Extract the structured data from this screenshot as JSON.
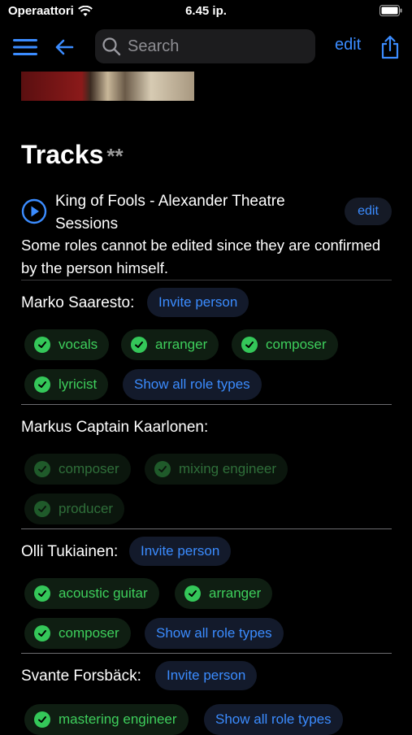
{
  "status_bar": {
    "carrier": "Operaattori",
    "time": "6.45 ip."
  },
  "nav": {
    "search_placeholder": "Search",
    "edit_label": "edit"
  },
  "tracks": {
    "title": "Tracks",
    "stars": "**"
  },
  "track": {
    "title": "King of Fools - Alexander Theatre Sessions",
    "edit_label": "edit",
    "notice": "Some roles cannot be edited since they are confirmed by the person himself."
  },
  "people": [
    {
      "name": "Marko Saaresto:",
      "invite_label": "Invite person",
      "roles": [
        "vocals",
        "arranger",
        "composer",
        "lyricist"
      ],
      "show_all_label": "Show all role types"
    },
    {
      "name": "Markus Captain Kaarlonen:",
      "roles": [
        "composer",
        "mixing engineer",
        "producer"
      ]
    },
    {
      "name": "Olli Tukiainen:",
      "invite_label": "Invite person",
      "roles": [
        "acoustic guitar",
        "arranger",
        "composer"
      ],
      "show_all_label": "Show all role types"
    },
    {
      "name": "Svante Forsbäck:",
      "invite_label": "Invite person",
      "roles": [
        "mastering engineer"
      ],
      "show_all_label": "Show all role types"
    }
  ],
  "colors": {
    "accent": "#3b8cff",
    "confirmed": "#34c759",
    "background": "#000000"
  },
  "icons": [
    "wifi-icon",
    "battery-icon",
    "menu-icon",
    "back-arrow-icon",
    "search-icon",
    "share-icon",
    "play-circle-icon",
    "checkmark-circle-icon"
  ]
}
